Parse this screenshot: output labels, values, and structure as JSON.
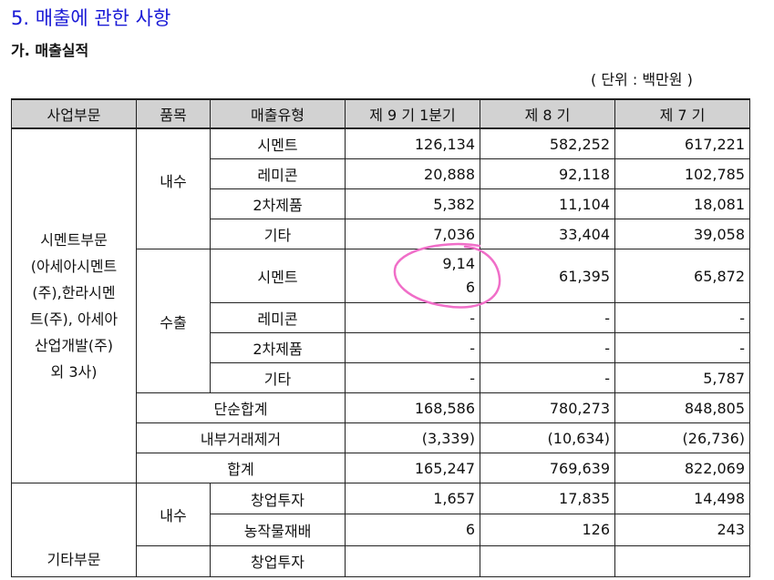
{
  "section": {
    "title": "5. 매출에 관한 사항",
    "subtitle": "가. 매출실적",
    "unit": "( 단위 : 백만원 )"
  },
  "table": {
    "headers": [
      "사업부문",
      "품목",
      "매출유형",
      "제 9 기 1분기",
      "제 8 기",
      "제 7 기"
    ],
    "cement_division": {
      "division_lines": [
        "시멘트부문",
        "(아세아시멘트",
        "(주),한라시멘",
        "트(주), 아세아",
        "산업개발(주)",
        "외 3사)"
      ],
      "domestic": {
        "label": "내수",
        "rows": [
          {
            "type": "시멘트",
            "v9": "126,134",
            "v8": "582,252",
            "v7": "617,221"
          },
          {
            "type": "레미콘",
            "v9": "20,888",
            "v8": "92,118",
            "v7": "102,785"
          },
          {
            "type": "2차제품",
            "v9": "5,382",
            "v8": "11,104",
            "v7": "18,081"
          },
          {
            "type": "기타",
            "v9": "7,036",
            "v8": "33,404",
            "v7": "39,058"
          }
        ]
      },
      "export": {
        "label": "수출",
        "first": {
          "type": "시멘트",
          "v9_line1": "9,14",
          "v9_line2": "6",
          "v8": "61,395",
          "v7": "65,872"
        },
        "rows": [
          {
            "type": "레미콘",
            "v9": "-",
            "v8": "-",
            "v7": "-"
          },
          {
            "type": "2차제품",
            "v9": "-",
            "v8": "-",
            "v7": "-"
          },
          {
            "type": "기타",
            "v9": "-",
            "v8": "-",
            "v7": "5,787"
          }
        ]
      },
      "totals": [
        {
          "label": "단순합계",
          "v9": "168,586",
          "v8": "780,273",
          "v7": "848,805"
        },
        {
          "label": "내부거래제거",
          "v9": "(3,339)",
          "v8": "(10,634)",
          "v7": "(26,736)"
        },
        {
          "label": "합계",
          "v9": "165,247",
          "v8": "769,639",
          "v7": "822,069"
        }
      ]
    },
    "other_division": {
      "division": "기타부문",
      "domestic": {
        "label": "내수",
        "rows": [
          {
            "type": "창업투자",
            "v9": "1,657",
            "v8": "17,835",
            "v7": "14,498"
          },
          {
            "type": "농작물재배",
            "v9": "6",
            "v8": "126",
            "v7": "243"
          },
          {
            "type": "창업투자",
            "v9": "",
            "v8": "",
            "v7": ""
          }
        ]
      }
    }
  },
  "colors": {
    "title_blue": "#1a1ad6",
    "header_gray": "#d2d2d2",
    "annotation_pink": "#f06ec8"
  }
}
